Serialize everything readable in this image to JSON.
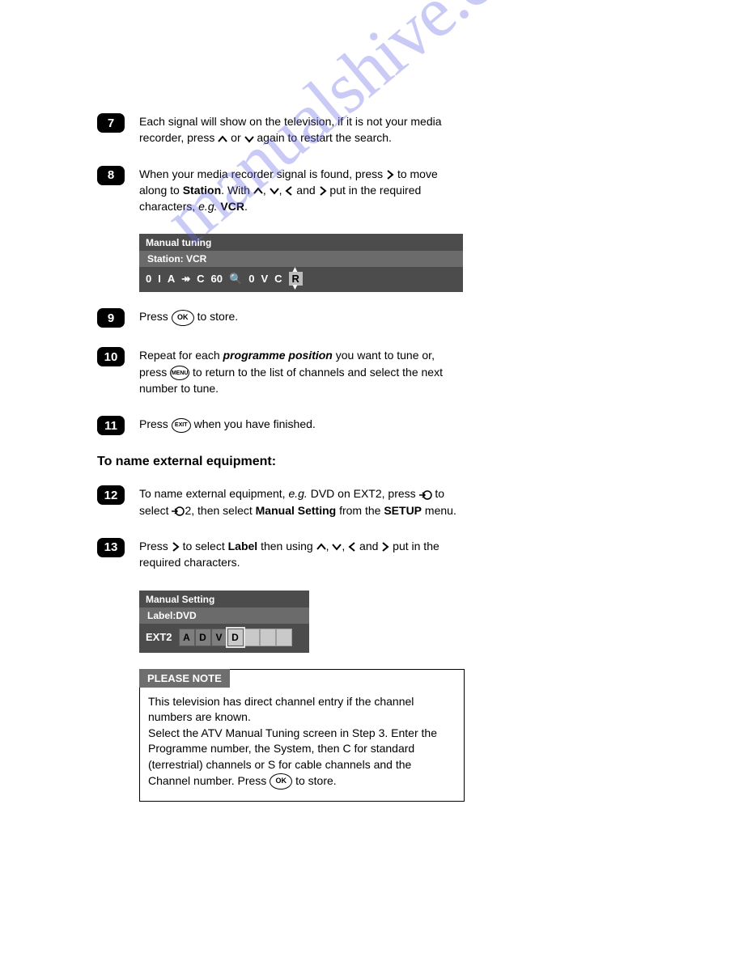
{
  "watermark": "manualshive.com",
  "steps": {
    "s7": {
      "num": "7",
      "t1": "Each signal will show on the television, if it is not your media recorder, press ",
      "t2": " or ",
      "t3": " again to restart the search."
    },
    "s8": {
      "num": "8",
      "t1": "When your media recorder signal is found, press ",
      "t2": " to move along to ",
      "b1": "Station",
      "t3": ". With ",
      "t4": ", ",
      "t5": ", ",
      "t6": " and ",
      "t7": " put in the required characters, ",
      "i1": "e.g.",
      "b2": " VCR",
      "dot": "."
    },
    "s9": {
      "num": "9",
      "t1": "Press ",
      "ok": "OK",
      "t2": " to store."
    },
    "s10": {
      "num": "10",
      "t1": "Repeat for each ",
      "bi1": "programme position",
      "t2": " you want to tune or, press ",
      "menu": "MENU",
      "t3": " to return to the list of channels and select the next number to tune."
    },
    "s11": {
      "num": "11",
      "t1": "Press ",
      "exit": "EXIT",
      "t2": " when you have finished."
    },
    "heading": "To name external equipment:",
    "s12": {
      "num": "12",
      "t1": "To name external equipment, ",
      "i1": "e.g.",
      "t2": " DVD on EXT2, press ",
      "t3": " to select ",
      "t4": "2, then select ",
      "b1": "Manual Setting",
      "t5": " from the ",
      "b2": "SETUP",
      "t6": " menu."
    },
    "s13": {
      "num": "13",
      "t1": "Press ",
      "t2": " to select ",
      "b1": "Label",
      "t3": " then using ",
      "t4": ", ",
      "t5": ", ",
      "t6": " and ",
      "t7": " put in the required characters."
    }
  },
  "panel1": {
    "title": "Manual tuning",
    "sub": "Station:  VCR",
    "cells": [
      "0",
      "I",
      "A",
      "↠",
      "C",
      "60",
      "🔍",
      "0",
      "V",
      "C",
      "R"
    ]
  },
  "panel2": {
    "title": "Manual Setting",
    "sub": "Label:DVD",
    "left": "EXT2",
    "cells": [
      "A",
      "D",
      "V",
      "D",
      "",
      "",
      ""
    ]
  },
  "note": {
    "head": "PLEASE NOTE",
    "t1": "This television has direct channel entry if the channel numbers are known.",
    "t2a": "Select the ",
    "b1": "ATV Manual Tuning",
    "t2b": " screen in ",
    "bi1": "Step 3",
    "t2c": ". Enter the ",
    "b2": "Programme number",
    "t2d": ", the ",
    "b3": "System",
    "t2e": ", then ",
    "b4": "C",
    "t2f": " for standard (terrestrial) channels or ",
    "b5": "S",
    "t2g": " for cable channels and the ",
    "b6": "Channel",
    "t2h": " number. Press ",
    "ok": "OK",
    "t2i": " to store."
  }
}
